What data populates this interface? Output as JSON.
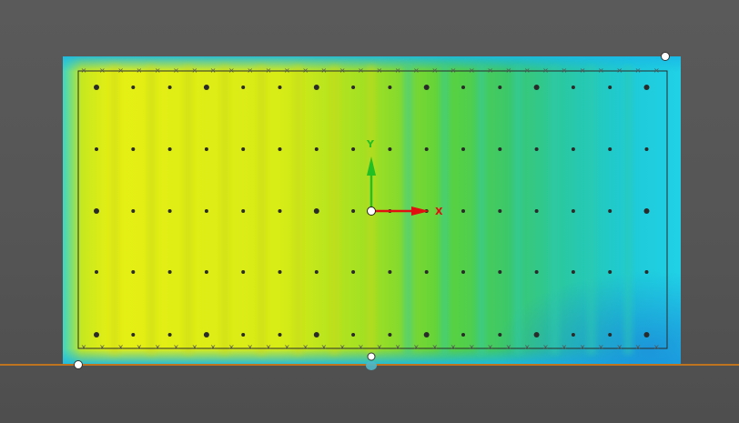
{
  "viewport": {
    "triad": {
      "x_label": "X",
      "y_label": "Y"
    },
    "colors": {
      "background": "#555555",
      "ground_line": "#ff8a00",
      "x_axis": "#e01010",
      "y_axis": "#22c022",
      "cold": "#18c8e8",
      "mid": "#56d23a",
      "hot": "#e4ef14"
    },
    "legend_visible": false
  }
}
